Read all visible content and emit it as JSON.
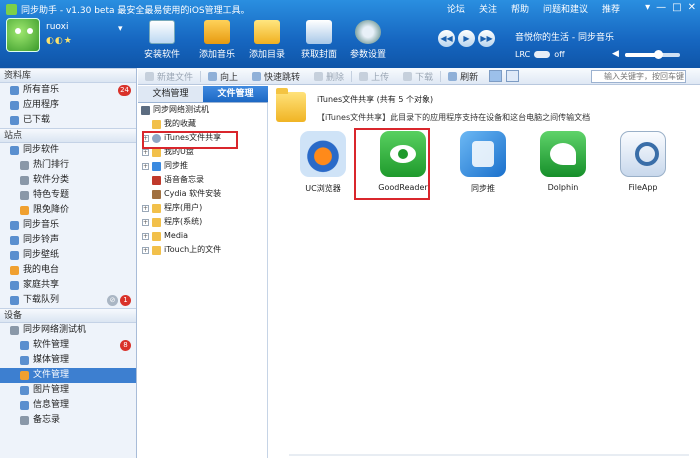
{
  "window": {
    "title": "同步助手 - v1.30 beta 最安全最易使用的iOS管理工具。",
    "top_menu": [
      "论坛",
      "关注",
      "帮助",
      "问题和建议",
      "推荐"
    ],
    "controls": [
      "▾",
      "—",
      "□",
      "✕"
    ]
  },
  "user": {
    "name": "ruoxi",
    "status_icons": "◐◐★",
    "dropdown": "▾"
  },
  "toolbar_main": [
    {
      "label": "安装软件"
    },
    {
      "label": "添加音乐"
    },
    {
      "label": "添加目录"
    },
    {
      "label": "获取封面"
    },
    {
      "label": "参数设置"
    }
  ],
  "player": {
    "now_playing": "音悦你的生活 - 同步音乐",
    "lrc_label": "LRC",
    "lrc_state": "off",
    "buttons": [
      "◀◀",
      "▶",
      "▶▶"
    ]
  },
  "sidebar": {
    "library_header": "资料库",
    "library": [
      {
        "label": "所有音乐",
        "badge": "24"
      },
      {
        "label": "应用程序"
      },
      {
        "label": "已下载"
      }
    ],
    "station_header": "站点",
    "station": [
      {
        "label": "同步软件",
        "level": 1
      },
      {
        "label": "热门排行",
        "level": 2
      },
      {
        "label": "软件分类",
        "level": 2
      },
      {
        "label": "特色专题",
        "level": 2
      },
      {
        "label": "限免降价",
        "level": 2
      },
      {
        "label": "同步音乐",
        "level": 1
      },
      {
        "label": "同步铃声",
        "level": 1
      },
      {
        "label": "同步壁纸",
        "level": 1
      },
      {
        "label": "我的电台",
        "level": 1
      },
      {
        "label": "家庭共享",
        "level": 1
      },
      {
        "label": "下载队列",
        "level": 1,
        "badge": "1",
        "badge2": "⊘"
      }
    ],
    "device_header": "设备",
    "device": [
      {
        "label": "同步网络测试机",
        "level": 1
      },
      {
        "label": "软件管理",
        "level": 2,
        "badge": "8"
      },
      {
        "label": "媒体管理",
        "level": 2
      },
      {
        "label": "文件管理",
        "level": 2,
        "selected": true
      },
      {
        "label": "图片管理",
        "level": 2
      },
      {
        "label": "信息管理",
        "level": 2
      },
      {
        "label": "备忘录",
        "level": 2
      }
    ]
  },
  "file_toolbar": {
    "new_folder": "新建文件",
    "up": "向上",
    "jump": "快速跳转",
    "delete": "删除",
    "upload": "上传",
    "download": "下载",
    "refresh": "刷新",
    "search_placeholder": "输入关键字，按回车键"
  },
  "tabs": {
    "doc": "文档管理",
    "file": "文件管理"
  },
  "tree": [
    {
      "label": "同步网络测试机",
      "indent": 0,
      "icon": "phone-icon",
      "exp": ""
    },
    {
      "label": "我的收藏",
      "indent": 1,
      "icon": "star-folder-icon",
      "exp": ""
    },
    {
      "label": "iTunes文件共享",
      "indent": 1,
      "icon": "itunes-icon",
      "exp": "+"
    },
    {
      "label": "我的U盘",
      "indent": 1,
      "icon": "folder-icon",
      "exp": "+"
    },
    {
      "label": "同步推",
      "indent": 1,
      "icon": "app-icon",
      "exp": "+"
    },
    {
      "label": "语音备忘录",
      "indent": 1,
      "icon": "mic-icon",
      "exp": ""
    },
    {
      "label": "Cydia 软件安装",
      "indent": 1,
      "icon": "cydia-icon",
      "exp": ""
    },
    {
      "label": "程序(用户)",
      "indent": 1,
      "icon": "folder-icon",
      "exp": "+"
    },
    {
      "label": "程序(系统)",
      "indent": 1,
      "icon": "folder-icon",
      "exp": "+"
    },
    {
      "label": "Media",
      "indent": 1,
      "icon": "folder-icon",
      "exp": "+"
    },
    {
      "label": "iTouch上的文件",
      "indent": 1,
      "icon": "folder-icon",
      "exp": "+"
    }
  ],
  "content": {
    "title": "iTunes文件共享 (共有 5 个对象)",
    "description": "【iTunes文件共享】此目录下的应用程序支持在设备和这台电脑之间传输文档",
    "apps": [
      {
        "name": "UC浏览器"
      },
      {
        "name": "GoodReader"
      },
      {
        "name": "同步推"
      },
      {
        "name": "Dolphin"
      },
      {
        "name": "FileApp"
      }
    ]
  }
}
